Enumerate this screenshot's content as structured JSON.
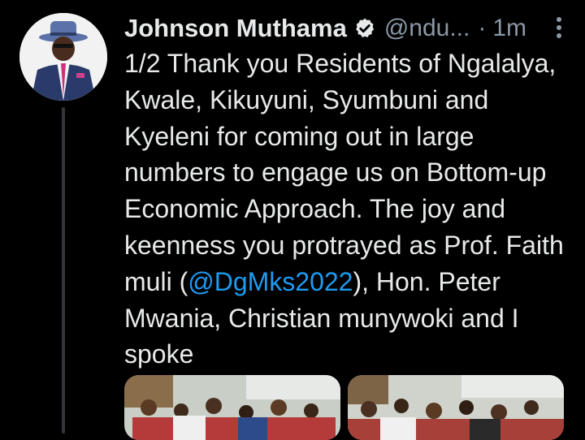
{
  "tweet": {
    "author_name": "Johnson Muthama",
    "handle": "@ndu...",
    "separator": "·",
    "time": "1m",
    "text_before": "1/2 Thank you Residents of Ngalalya, Kwale, Kikuyuni, Syumbuni and Kyeleni for coming out in large numbers to engage us on Bottom-up Economic Approach. The joy and keenness you protrayed as Prof. Faith muli (",
    "mention": "@DgMks2022",
    "text_after": "),  Hon. Peter Mwania, Christian munywoki and I spoke",
    "icons": {
      "verified": "verified-badge-icon",
      "more": "more-options-icon",
      "avatar": "profile-avatar"
    }
  },
  "colors": {
    "background": "#000000",
    "text": "#e7e9ea",
    "secondary": "#8b98a5",
    "link": "#1d9bf0",
    "thread_line": "#333639"
  }
}
